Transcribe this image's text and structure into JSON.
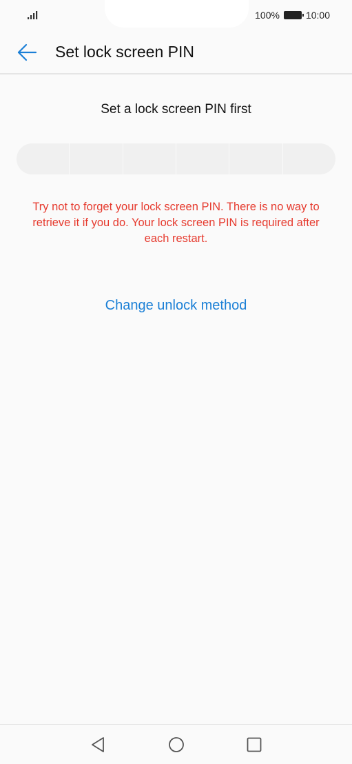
{
  "status_bar": {
    "battery_percent": "100%",
    "time": "10:00",
    "signal_icon": "signal-icon",
    "battery_icon": "battery-icon"
  },
  "header": {
    "title": "Set lock screen PIN",
    "back_icon": "arrow-left-icon"
  },
  "content": {
    "prompt": "Set a lock screen PIN first",
    "pin_cells": 6,
    "warning": "Try not to forget your lock screen PIN. There is no way to retrieve it if you do. Your lock screen PIN is required after each restart.",
    "change_method_label": "Change unlock method"
  },
  "nav_bar": {
    "back_icon": "triangle-back-icon",
    "home_icon": "circle-home-icon",
    "recents_icon": "square-recents-icon"
  },
  "colors": {
    "accent": "#1a7fd6",
    "warning": "#e63a2e",
    "background": "#fafafa"
  }
}
